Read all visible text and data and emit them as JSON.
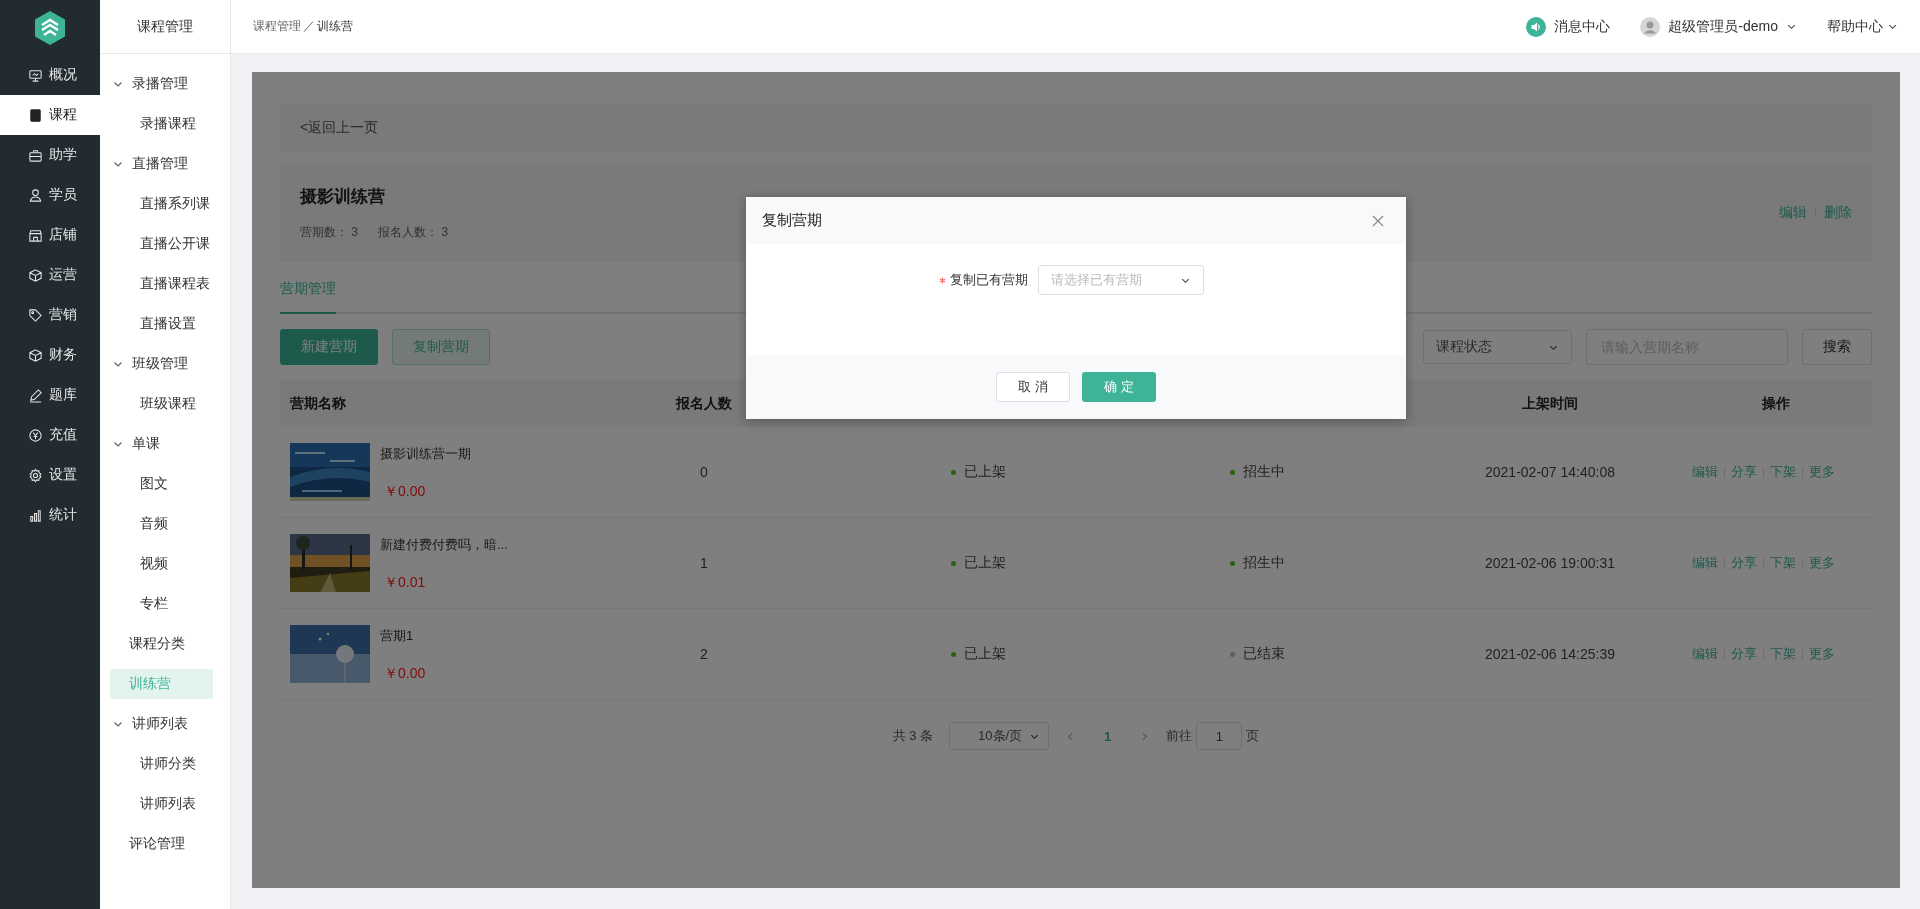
{
  "rail": {
    "items": [
      {
        "label": "概况",
        "kind": "monitor",
        "selected": false
      },
      {
        "label": "课程",
        "kind": "book",
        "selected": true
      },
      {
        "label": "助学",
        "kind": "briefcase",
        "selected": false
      },
      {
        "label": "学员",
        "kind": "user",
        "selected": false
      },
      {
        "label": "店铺",
        "kind": "store",
        "selected": false
      },
      {
        "label": "运营",
        "kind": "cube",
        "selected": false
      },
      {
        "label": "营销",
        "kind": "tag",
        "selected": false
      },
      {
        "label": "财务",
        "kind": "cube",
        "selected": false
      },
      {
        "label": "题库",
        "kind": "pencil",
        "selected": false
      },
      {
        "label": "充值",
        "kind": "yen",
        "selected": false
      },
      {
        "label": "设置",
        "kind": "gear",
        "selected": false
      },
      {
        "label": "统计",
        "kind": "chart",
        "selected": false
      }
    ]
  },
  "subnav": {
    "title": "课程管理",
    "items": [
      {
        "label": "录播管理",
        "expanded": true,
        "selected": false,
        "children": [
          {
            "label": "录播课程",
            "selected": false
          }
        ]
      },
      {
        "label": "直播管理",
        "expanded": true,
        "selected": false,
        "children": [
          {
            "label": "直播系列课",
            "selected": false
          },
          {
            "label": "直播公开课",
            "selected": false
          },
          {
            "label": "直播课程表",
            "selected": false
          },
          {
            "label": "直播设置",
            "selected": false
          }
        ]
      },
      {
        "label": "班级管理",
        "expanded": true,
        "selected": false,
        "children": [
          {
            "label": "班级课程",
            "selected": false
          }
        ]
      },
      {
        "label": "单课",
        "expanded": true,
        "selected": false,
        "children": [
          {
            "label": "图文",
            "selected": false
          },
          {
            "label": "音频",
            "selected": false
          },
          {
            "label": "视频",
            "selected": false
          },
          {
            "label": "专栏",
            "selected": false
          }
        ]
      },
      {
        "label": "课程分类",
        "selected": false
      },
      {
        "label": "训练营",
        "selected": true
      },
      {
        "label": "讲师列表",
        "expanded": true,
        "selected": false,
        "children": [
          {
            "label": "讲师分类",
            "selected": false
          },
          {
            "label": "讲师列表",
            "selected": false
          }
        ]
      },
      {
        "label": "评论管理",
        "selected": false
      }
    ]
  },
  "topbar": {
    "breadcrumb": [
      "课程管理",
      "训练营"
    ],
    "separator": "／",
    "messages": "消息中心",
    "user": "超级管理员-demo",
    "help": "帮助中心"
  },
  "content": {
    "back_link": "<返回上一页",
    "camp": {
      "title": "摄影训练营",
      "stats": [
        {
          "label": "营期数：",
          "value": "3"
        },
        {
          "label": "报名人数：",
          "value": "3"
        }
      ],
      "actions": [
        "编辑",
        "删除"
      ]
    },
    "tabs": [
      {
        "label": "营期管理",
        "selected": true
      }
    ],
    "buttons": [
      {
        "label": "新建营期",
        "kind": "primary"
      },
      {
        "label": "复制营期",
        "kind": "secondary"
      }
    ],
    "status_select": {
      "value": "课程状态"
    },
    "search": {
      "placeholder": "请输入营期名称"
    },
    "search_button": "搜索",
    "table": {
      "header": {
        "name": "营期名称",
        "enrolled": "报名人数",
        "listed_at": "上架时间",
        "actions": "操作"
      },
      "rows": [
        {
          "name": "摄影训练营一期",
          "price": "￥0.00",
          "enrolled": "0",
          "listing": {
            "label": "已上架",
            "color": "#29620d"
          },
          "recruit": {
            "label": "招生中",
            "color": "#29620d"
          },
          "listed_at": "2021-02-07 14:40:08",
          "actions": [
            "编辑",
            "分享",
            "下架",
            "更多"
          ]
        },
        {
          "name": "新建付费付费吗，暗...",
          "price": "￥0.01",
          "enrolled": "1",
          "listing": {
            "label": "已上架",
            "color": "#29620d"
          },
          "recruit": {
            "label": "招生中",
            "color": "#29620d"
          },
          "listed_at": "2021-02-06 19:00:31",
          "actions": [
            "编辑",
            "分享",
            "下架",
            "更多"
          ]
        },
        {
          "name": "营期1",
          "price": "￥0.00",
          "enrolled": "2",
          "listing": {
            "label": "已上架",
            "color": "#29620d"
          },
          "recruit": {
            "label": "已结束",
            "color": "#5e5e5e"
          },
          "listed_at": "2021-02-06 14:25:39",
          "actions": [
            "编辑",
            "分享",
            "下架",
            "更多"
          ]
        }
      ]
    },
    "pagination": {
      "total": "共 3 条",
      "page_size": "10条/页",
      "pages": [
        {
          "label": "1",
          "selected": true
        }
      ],
      "goto_label": "前往",
      "goto_value": "1",
      "goto_suffix": "页"
    }
  },
  "modal": {
    "title": "复制营期",
    "field": {
      "label": "复制已有营期",
      "required": true,
      "placeholder": "请选择已有营期"
    },
    "buttons": [
      {
        "label": "取 消",
        "kind": "default"
      },
      {
        "label": "确 定",
        "kind": "primary"
      }
    ]
  }
}
